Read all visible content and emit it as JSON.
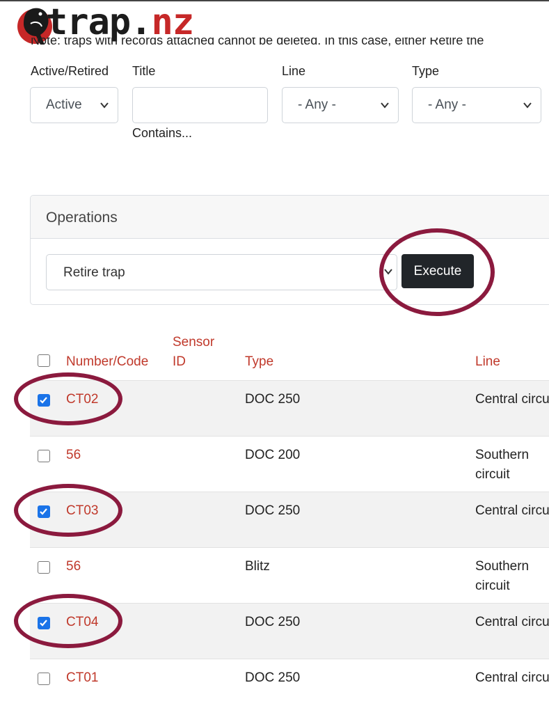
{
  "brand": {
    "part1": "trap.",
    "part2": "nz"
  },
  "note": "Note: traps with records attached cannot be deleted. In this case, either Retire the",
  "filters": {
    "status": {
      "label": "Active/Retired",
      "value": "Active"
    },
    "title": {
      "label": "Title",
      "value": "",
      "hint": "Contains..."
    },
    "line": {
      "label": "Line",
      "value": "- Any -"
    },
    "type": {
      "label": "Type",
      "value": "- Any -"
    }
  },
  "operations": {
    "title": "Operations",
    "selected": "Retire trap",
    "execute_label": "Execute"
  },
  "table": {
    "headers": {
      "code": "Number/Code",
      "sensor_line1": "Sensor",
      "sensor_line2": "ID",
      "type": "Type",
      "line": "Line"
    },
    "rows": [
      {
        "code": "CT02",
        "sensor": "",
        "type": "DOC 250",
        "line1": "Central circu",
        "line2": "",
        "checked": true
      },
      {
        "code": "56",
        "sensor": "",
        "type": "DOC 200",
        "line1": "Southern",
        "line2": "circuit",
        "checked": false
      },
      {
        "code": "CT03",
        "sensor": "",
        "type": "DOC 250",
        "line1": "Central circu",
        "line2": "",
        "checked": true
      },
      {
        "code": "56",
        "sensor": "",
        "type": "Blitz",
        "line1": "Southern",
        "line2": "circuit",
        "checked": false
      },
      {
        "code": "CT04",
        "sensor": "",
        "type": "DOC 250",
        "line1": "Central circu",
        "line2": "",
        "checked": true
      },
      {
        "code": "CT01",
        "sensor": "",
        "type": "DOC 250",
        "line1": "Central circu",
        "line2": "",
        "checked": false
      }
    ]
  },
  "colors": {
    "accent": "#c0392b",
    "highlight_ring": "#8b1a3e",
    "checkbox": "#1a73e8"
  }
}
